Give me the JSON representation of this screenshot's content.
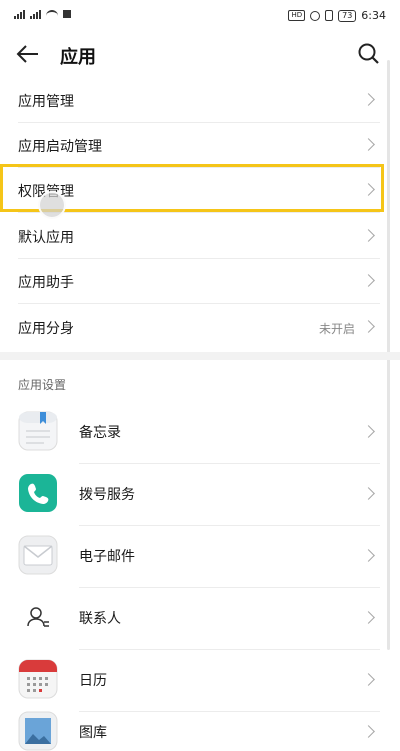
{
  "status_bar": {
    "left_icons": [
      "signal-icon",
      "wifi-icon",
      "notification-icon"
    ],
    "hd_label": "HD",
    "battery": "73",
    "time": "6:34"
  },
  "header": {
    "title": "应用",
    "back_icon": "back-arrow-icon",
    "search_icon": "search-icon"
  },
  "menu": [
    {
      "label": "应用管理",
      "value": ""
    },
    {
      "label": "应用启动管理",
      "value": ""
    },
    {
      "label": "权限管理",
      "value": "",
      "highlighted": true
    },
    {
      "label": "默认应用",
      "value": ""
    },
    {
      "label": "应用助手",
      "value": ""
    },
    {
      "label": "应用分身",
      "value": "未开启"
    }
  ],
  "app_settings": {
    "title": "应用设置",
    "items": [
      {
        "label": "备忘录",
        "icon": "memo-icon"
      },
      {
        "label": "拨号服务",
        "icon": "phone-icon"
      },
      {
        "label": "电子邮件",
        "icon": "email-icon"
      },
      {
        "label": "联系人",
        "icon": "contacts-icon"
      },
      {
        "label": "日历",
        "icon": "calendar-icon"
      },
      {
        "label": "图库",
        "icon": "gallery-icon"
      }
    ]
  },
  "colors": {
    "highlight": "#f5c518",
    "phone_green": "#1bb597",
    "calendar_red": "#d93b3b"
  }
}
